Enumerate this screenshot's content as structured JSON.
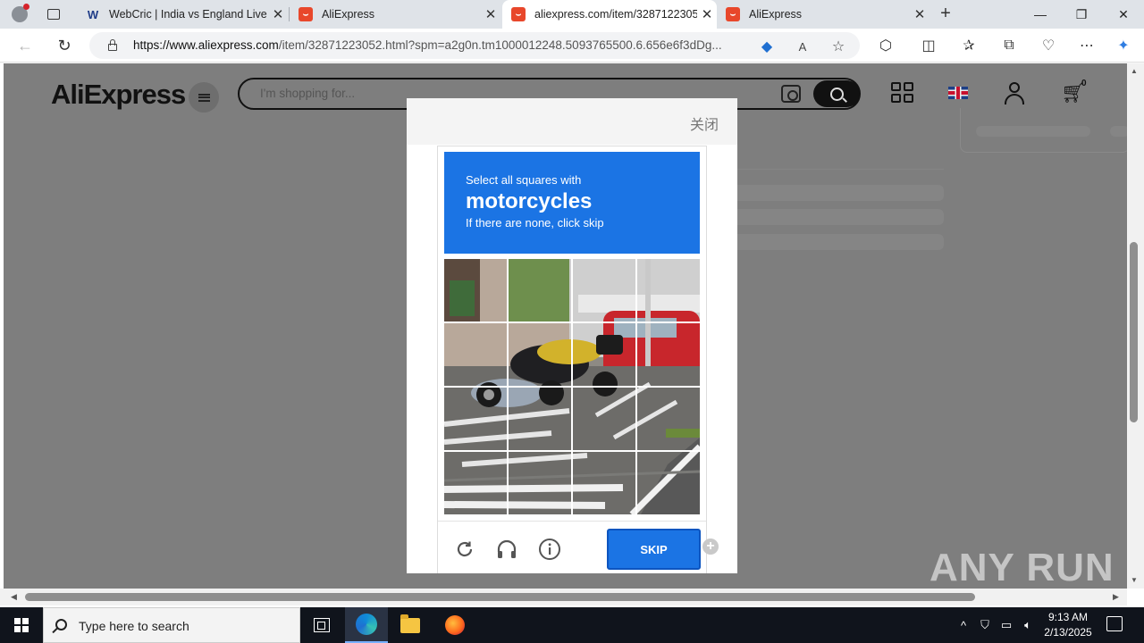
{
  "browser": {
    "tabs": [
      {
        "title": "WebCric | India vs England Live C",
        "favicon": "webcric-icon",
        "active": false
      },
      {
        "title": "AliExpress",
        "favicon": "aliexpress-icon",
        "active": false
      },
      {
        "title": "aliexpress.com/item/3287122305",
        "favicon": "aliexpress-icon",
        "active": true
      },
      {
        "title": "AliExpress",
        "favicon": "aliexpress-icon",
        "active": false
      }
    ],
    "new_tab": "+",
    "url_domain": "https://www.aliexpress.com",
    "url_path": "/item/32871223052.html?spm=a2g0n.tm1000012248.5093765500.6.656e6f3dDg..."
  },
  "site": {
    "logo": "AliExpress",
    "search_placeholder": "I'm shopping for...",
    "cart_count": "0"
  },
  "captcha": {
    "close_label": "关闭",
    "prompt_line1": "Select all squares with",
    "prompt_target": "motorcycles",
    "prompt_line3": "If there are none, click skip",
    "skip_label": "SKIP",
    "plus_badge": "+"
  },
  "watermark": "ANY RUN",
  "taskbar": {
    "search_placeholder": "Type here to search",
    "time": "9:13 AM",
    "date": "2/13/2025"
  },
  "colors": {
    "captcha_blue": "#1b74e4",
    "overlay_gray": "#7e7e7e",
    "taskbar": "#10141c"
  }
}
